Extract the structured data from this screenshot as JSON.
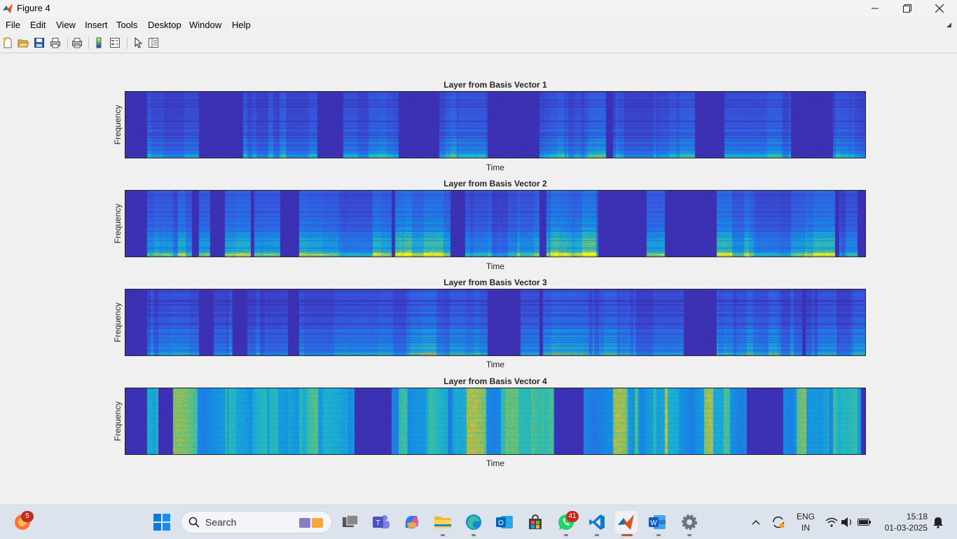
{
  "window": {
    "title": "Figure 4"
  },
  "menu": [
    "File",
    "Edit",
    "View",
    "Insert",
    "Tools",
    "Desktop",
    "Window",
    "Help"
  ],
  "toolbar": {
    "buttons": [
      "new-figure-icon",
      "open-file-icon",
      "save-icon",
      "print-icon",
      "print-preview-icon",
      "colorbar-icon",
      "legend-icon",
      "pointer-icon",
      "property-inspector-icon"
    ]
  },
  "figure": {
    "colormap": "parula",
    "axes": [
      {
        "title": "Layer from Basis Vector 1",
        "xlabel": "Time",
        "ylabel": "Frequency"
      },
      {
        "title": "Layer from Basis Vector 2",
        "xlabel": "Time",
        "ylabel": "Frequency"
      },
      {
        "title": "Layer from Basis Vector 3",
        "xlabel": "Time",
        "ylabel": "Frequency"
      },
      {
        "title": "Layer from Basis Vector 4",
        "xlabel": "Time",
        "ylabel": "Frequency"
      }
    ]
  },
  "taskbar": {
    "search_label": "Search",
    "firefox_badge": "5",
    "whatsapp_badge": "41",
    "apps": [
      "firefox-icon",
      "start-icon",
      "search-icon",
      "widgets-icon",
      "task-view-icon",
      "teams-icon",
      "copilot-icon",
      "file-explorer-icon",
      "edge-icon",
      "outlook-icon",
      "store-icon",
      "whatsapp-icon",
      "vscode-icon",
      "matlab-icon",
      "word-icon",
      "settings-icon"
    ]
  },
  "tray": {
    "language": "ENG",
    "region": "IN",
    "time": "15:18",
    "date": "01-03-2025"
  },
  "colors": {
    "parula_low": "#3e26a8",
    "parula_high": "#f9fb0e",
    "taskbar_bg": "#dde3ec"
  }
}
